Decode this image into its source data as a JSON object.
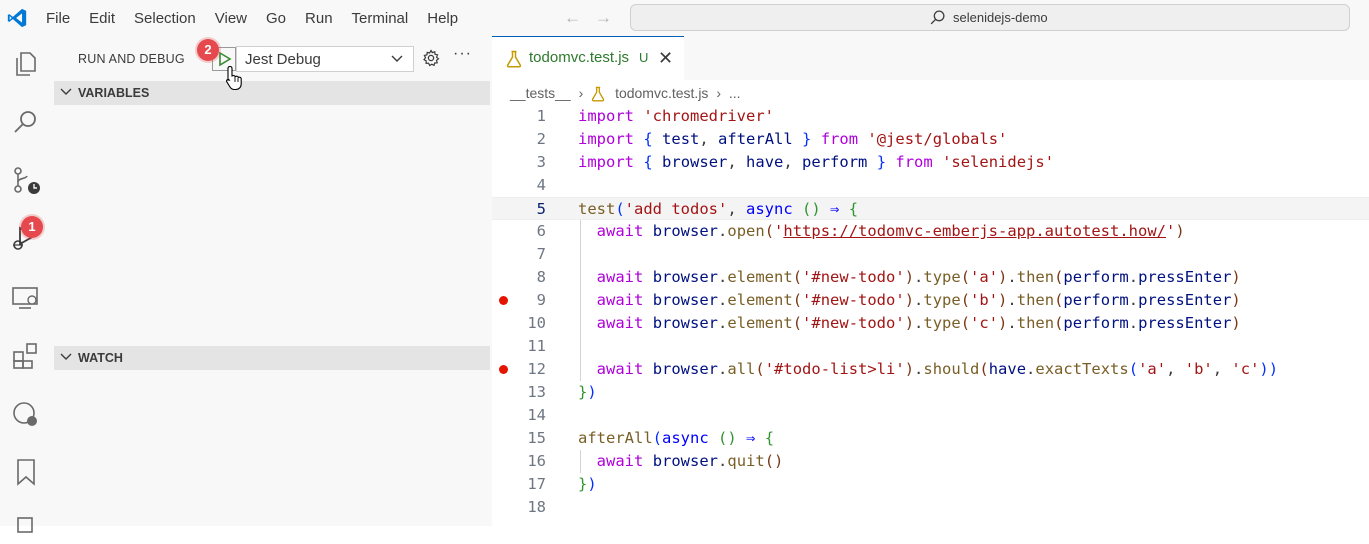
{
  "menu": [
    "File",
    "Edit",
    "Selection",
    "View",
    "Go",
    "Run",
    "Terminal",
    "Help"
  ],
  "command_center": {
    "text": "selenidejs-demo"
  },
  "activity_badges": {
    "debug": "1",
    "run": "2"
  },
  "sidebar": {
    "title": "RUN AND DEBUG",
    "config": "Jest Debug",
    "sections": {
      "variables": "VARIABLES",
      "watch": "WATCH"
    }
  },
  "tab": {
    "name": "todomvc.test.js",
    "status": "U"
  },
  "breadcrumb": {
    "folder": "__tests__",
    "file": "todomvc.test.js",
    "more": "..."
  },
  "code": {
    "lines": [
      {
        "n": "1",
        "bp": false,
        "tokens": [
          [
            "kw2",
            "import"
          ],
          [
            "pl",
            " "
          ],
          [
            "str",
            "'chromedriver'"
          ]
        ]
      },
      {
        "n": "2",
        "bp": false,
        "tokens": [
          [
            "kw2",
            "import"
          ],
          [
            "pl",
            " "
          ],
          [
            "br1",
            "{"
          ],
          [
            "pl",
            " "
          ],
          [
            "id",
            "test"
          ],
          [
            "pl",
            ", "
          ],
          [
            "id",
            "afterAll"
          ],
          [
            "pl",
            " "
          ],
          [
            "br1",
            "}"
          ],
          [
            "pl",
            " "
          ],
          [
            "kw2",
            "from"
          ],
          [
            "pl",
            " "
          ],
          [
            "str",
            "'@jest/globals'"
          ]
        ]
      },
      {
        "n": "3",
        "bp": false,
        "tokens": [
          [
            "kw2",
            "import"
          ],
          [
            "pl",
            " "
          ],
          [
            "br1",
            "{"
          ],
          [
            "pl",
            " "
          ],
          [
            "id",
            "browser"
          ],
          [
            "pl",
            ", "
          ],
          [
            "id",
            "have"
          ],
          [
            "pl",
            ", "
          ],
          [
            "id",
            "perform"
          ],
          [
            "pl",
            " "
          ],
          [
            "br1",
            "}"
          ],
          [
            "pl",
            " "
          ],
          [
            "kw2",
            "from"
          ],
          [
            "pl",
            " "
          ],
          [
            "str",
            "'selenidejs'"
          ]
        ]
      },
      {
        "n": "4",
        "bp": false,
        "tokens": []
      },
      {
        "n": "5",
        "bp": false,
        "active": true,
        "tokens": [
          [
            "fn",
            "test"
          ],
          [
            "br1",
            "("
          ],
          [
            "str",
            "'add todos'"
          ],
          [
            "pl",
            ", "
          ],
          [
            "kw",
            "async"
          ],
          [
            "pl",
            " "
          ],
          [
            "br2",
            "()"
          ],
          [
            "pl",
            " "
          ],
          [
            "kw",
            "⇒"
          ],
          [
            "pl",
            " "
          ],
          [
            "br2",
            "{"
          ]
        ]
      },
      {
        "n": "6",
        "bp": false,
        "tokens": [
          [
            "pl",
            "  "
          ],
          [
            "kw2",
            "await"
          ],
          [
            "pl",
            " "
          ],
          [
            "id",
            "browser"
          ],
          [
            "pl",
            "."
          ],
          [
            "fn",
            "open"
          ],
          [
            "br3",
            "("
          ],
          [
            "str",
            "'"
          ],
          [
            "url",
            "https://todomvc-emberjs-app.autotest.how/"
          ],
          [
            "str",
            "'"
          ],
          [
            "br3",
            ")"
          ]
        ]
      },
      {
        "n": "7",
        "bp": false,
        "tokens": []
      },
      {
        "n": "8",
        "bp": false,
        "tokens": [
          [
            "pl",
            "  "
          ],
          [
            "kw2",
            "await"
          ],
          [
            "pl",
            " "
          ],
          [
            "id",
            "browser"
          ],
          [
            "pl",
            "."
          ],
          [
            "fn",
            "element"
          ],
          [
            "br3",
            "("
          ],
          [
            "str",
            "'#new-todo'"
          ],
          [
            "br3",
            ")"
          ],
          [
            "pl",
            "."
          ],
          [
            "fn",
            "type"
          ],
          [
            "br3",
            "("
          ],
          [
            "str",
            "'a'"
          ],
          [
            "br3",
            ")"
          ],
          [
            "pl",
            "."
          ],
          [
            "fn",
            "then"
          ],
          [
            "br3",
            "("
          ],
          [
            "id",
            "perform"
          ],
          [
            "pl",
            "."
          ],
          [
            "id",
            "pressEnter"
          ],
          [
            "br3",
            ")"
          ]
        ]
      },
      {
        "n": "9",
        "bp": true,
        "tokens": [
          [
            "pl",
            "  "
          ],
          [
            "kw2",
            "await"
          ],
          [
            "pl",
            " "
          ],
          [
            "id",
            "browser"
          ],
          [
            "pl",
            "."
          ],
          [
            "fn",
            "element"
          ],
          [
            "br3",
            "("
          ],
          [
            "str",
            "'#new-todo'"
          ],
          [
            "br3",
            ")"
          ],
          [
            "pl",
            "."
          ],
          [
            "fn",
            "type"
          ],
          [
            "br3",
            "("
          ],
          [
            "str",
            "'b'"
          ],
          [
            "br3",
            ")"
          ],
          [
            "pl",
            "."
          ],
          [
            "fn",
            "then"
          ],
          [
            "br3",
            "("
          ],
          [
            "id",
            "perform"
          ],
          [
            "pl",
            "."
          ],
          [
            "id",
            "pressEnter"
          ],
          [
            "br3",
            ")"
          ]
        ]
      },
      {
        "n": "10",
        "bp": false,
        "tokens": [
          [
            "pl",
            "  "
          ],
          [
            "kw2",
            "await"
          ],
          [
            "pl",
            " "
          ],
          [
            "id",
            "browser"
          ],
          [
            "pl",
            "."
          ],
          [
            "fn",
            "element"
          ],
          [
            "br3",
            "("
          ],
          [
            "str",
            "'#new-todo'"
          ],
          [
            "br3",
            ")"
          ],
          [
            "pl",
            "."
          ],
          [
            "fn",
            "type"
          ],
          [
            "br3",
            "("
          ],
          [
            "str",
            "'c'"
          ],
          [
            "br3",
            ")"
          ],
          [
            "pl",
            "."
          ],
          [
            "fn",
            "then"
          ],
          [
            "br3",
            "("
          ],
          [
            "id",
            "perform"
          ],
          [
            "pl",
            "."
          ],
          [
            "id",
            "pressEnter"
          ],
          [
            "br3",
            ")"
          ]
        ]
      },
      {
        "n": "11",
        "bp": false,
        "tokens": []
      },
      {
        "n": "12",
        "bp": true,
        "tokens": [
          [
            "pl",
            "  "
          ],
          [
            "kw2",
            "await"
          ],
          [
            "pl",
            " "
          ],
          [
            "id",
            "browser"
          ],
          [
            "pl",
            "."
          ],
          [
            "fn",
            "all"
          ],
          [
            "br3",
            "("
          ],
          [
            "str",
            "'#todo-list>li'"
          ],
          [
            "br3",
            ")"
          ],
          [
            "pl",
            "."
          ],
          [
            "fn",
            "should"
          ],
          [
            "br3",
            "("
          ],
          [
            "id",
            "have"
          ],
          [
            "pl",
            "."
          ],
          [
            "fn",
            "exactTexts"
          ],
          [
            "br1",
            "("
          ],
          [
            "str",
            "'a'"
          ],
          [
            "pl",
            ", "
          ],
          [
            "str",
            "'b'"
          ],
          [
            "pl",
            ", "
          ],
          [
            "str",
            "'c'"
          ],
          [
            "br1",
            "))"
          ]
        ]
      },
      {
        "n": "13",
        "bp": false,
        "tokens": [
          [
            "br2",
            "}"
          ],
          [
            "br1",
            ")"
          ]
        ]
      },
      {
        "n": "14",
        "bp": false,
        "tokens": []
      },
      {
        "n": "15",
        "bp": false,
        "tokens": [
          [
            "fn",
            "afterAll"
          ],
          [
            "br1",
            "("
          ],
          [
            "kw",
            "async"
          ],
          [
            "pl",
            " "
          ],
          [
            "br2",
            "()"
          ],
          [
            "pl",
            " "
          ],
          [
            "kw",
            "⇒"
          ],
          [
            "pl",
            " "
          ],
          [
            "br2",
            "{"
          ]
        ]
      },
      {
        "n": "16",
        "bp": false,
        "tokens": [
          [
            "pl",
            "  "
          ],
          [
            "kw2",
            "await"
          ],
          [
            "pl",
            " "
          ],
          [
            "id",
            "browser"
          ],
          [
            "pl",
            "."
          ],
          [
            "fn",
            "quit"
          ],
          [
            "br3",
            "()"
          ]
        ]
      },
      {
        "n": "17",
        "bp": false,
        "tokens": [
          [
            "br2",
            "}"
          ],
          [
            "br1",
            ")"
          ]
        ]
      },
      {
        "n": "18",
        "bp": false,
        "tokens": []
      }
    ]
  }
}
